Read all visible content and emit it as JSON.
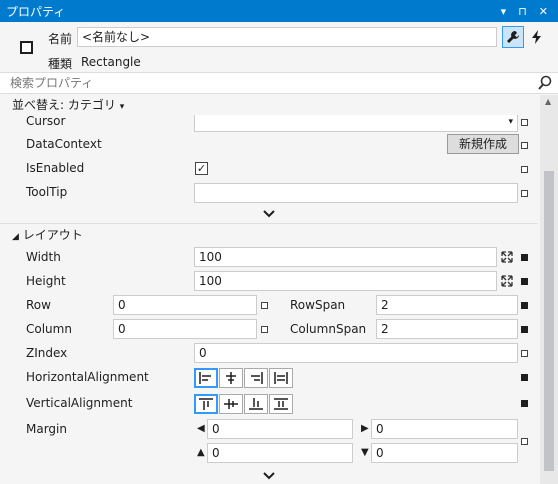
{
  "window": {
    "title": "プロパティ",
    "controls": [
      "▾",
      "⊓",
      "✕"
    ]
  },
  "header": {
    "name_label": "名前",
    "name_value": "<名前なし>",
    "type_label": "種類",
    "type_value": "Rectangle"
  },
  "search": {
    "placeholder": "検索プロパティ"
  },
  "sort": {
    "label": "並べ替え: カテゴリ",
    "arrow": "▾"
  },
  "misc": {
    "cursor_label": "Cursor",
    "datacontext_label": "DataContext",
    "new_button": "新規作成",
    "isenabled_label": "IsEnabled",
    "isenabled_check": "✓",
    "tooltip_label": "ToolTip"
  },
  "layout": {
    "section_title": "レイアウト",
    "width_label": "Width",
    "width_value": "100",
    "height_label": "Height",
    "height_value": "100",
    "row_label": "Row",
    "row_value": "0",
    "rowspan_label": "RowSpan",
    "rowspan_value": "2",
    "column_label": "Column",
    "column_value": "0",
    "columnspan_label": "ColumnSpan",
    "columnspan_value": "2",
    "zindex_label": "ZIndex",
    "zindex_value": "0",
    "halign_label": "HorizontalAlignment",
    "valign_label": "VerticalAlignment",
    "margin_label": "Margin",
    "margin_left": "0",
    "margin_right": "0",
    "margin_top": "0",
    "margin_bottom": "0"
  }
}
